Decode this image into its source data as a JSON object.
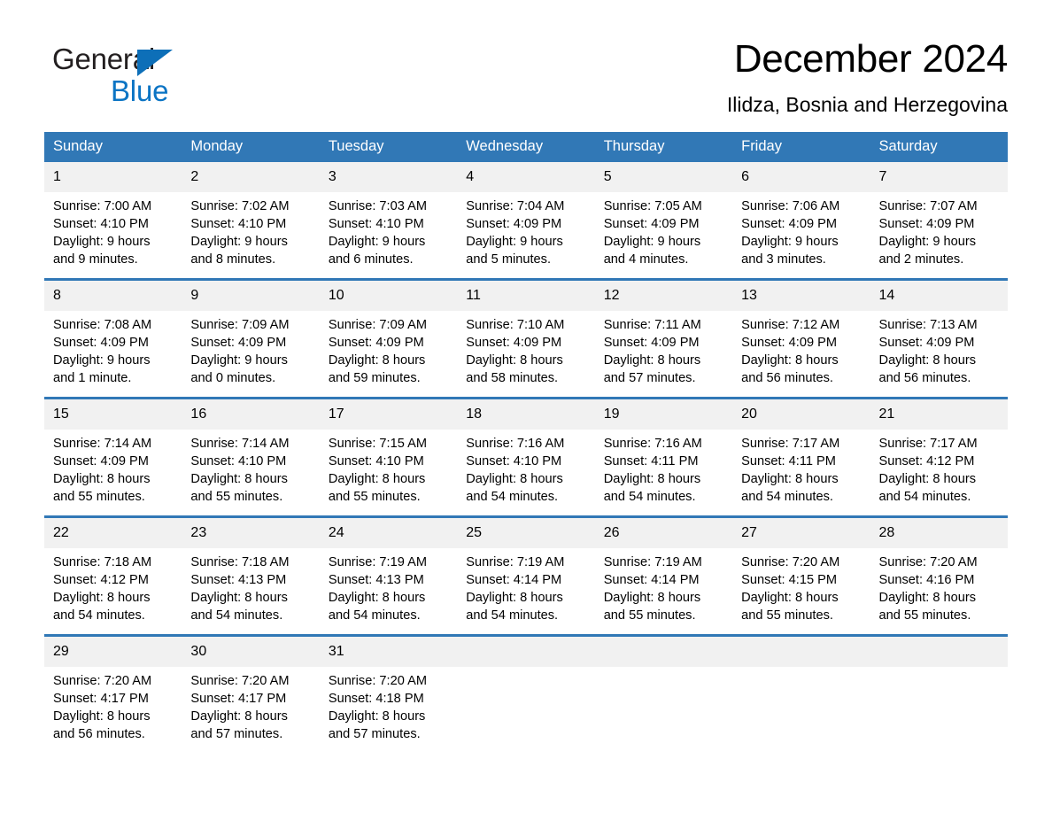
{
  "brand": {
    "name_top": "General",
    "name_bottom": "Blue",
    "accent_color": "#0b74c4",
    "triangle_color": "#0d6fb8"
  },
  "header": {
    "title": "December 2024",
    "subtitle": "Ilidza, Bosnia and Herzegovina"
  },
  "calendar": {
    "header_bg": "#3178b6",
    "header_text_color": "#ffffff",
    "daynum_bg": "#f1f1f1",
    "weekday_headers": [
      "Sunday",
      "Monday",
      "Tuesday",
      "Wednesday",
      "Thursday",
      "Friday",
      "Saturday"
    ],
    "weeks": [
      [
        {
          "day": "1",
          "sunrise": "Sunrise: 7:00 AM",
          "sunset": "Sunset: 4:10 PM",
          "daylight_1": "Daylight: 9 hours",
          "daylight_2": "and 9 minutes."
        },
        {
          "day": "2",
          "sunrise": "Sunrise: 7:02 AM",
          "sunset": "Sunset: 4:10 PM",
          "daylight_1": "Daylight: 9 hours",
          "daylight_2": "and 8 minutes."
        },
        {
          "day": "3",
          "sunrise": "Sunrise: 7:03 AM",
          "sunset": "Sunset: 4:10 PM",
          "daylight_1": "Daylight: 9 hours",
          "daylight_2": "and 6 minutes."
        },
        {
          "day": "4",
          "sunrise": "Sunrise: 7:04 AM",
          "sunset": "Sunset: 4:09 PM",
          "daylight_1": "Daylight: 9 hours",
          "daylight_2": "and 5 minutes."
        },
        {
          "day": "5",
          "sunrise": "Sunrise: 7:05 AM",
          "sunset": "Sunset: 4:09 PM",
          "daylight_1": "Daylight: 9 hours",
          "daylight_2": "and 4 minutes."
        },
        {
          "day": "6",
          "sunrise": "Sunrise: 7:06 AM",
          "sunset": "Sunset: 4:09 PM",
          "daylight_1": "Daylight: 9 hours",
          "daylight_2": "and 3 minutes."
        },
        {
          "day": "7",
          "sunrise": "Sunrise: 7:07 AM",
          "sunset": "Sunset: 4:09 PM",
          "daylight_1": "Daylight: 9 hours",
          "daylight_2": "and 2 minutes."
        }
      ],
      [
        {
          "day": "8",
          "sunrise": "Sunrise: 7:08 AM",
          "sunset": "Sunset: 4:09 PM",
          "daylight_1": "Daylight: 9 hours",
          "daylight_2": "and 1 minute."
        },
        {
          "day": "9",
          "sunrise": "Sunrise: 7:09 AM",
          "sunset": "Sunset: 4:09 PM",
          "daylight_1": "Daylight: 9 hours",
          "daylight_2": "and 0 minutes."
        },
        {
          "day": "10",
          "sunrise": "Sunrise: 7:09 AM",
          "sunset": "Sunset: 4:09 PM",
          "daylight_1": "Daylight: 8 hours",
          "daylight_2": "and 59 minutes."
        },
        {
          "day": "11",
          "sunrise": "Sunrise: 7:10 AM",
          "sunset": "Sunset: 4:09 PM",
          "daylight_1": "Daylight: 8 hours",
          "daylight_2": "and 58 minutes."
        },
        {
          "day": "12",
          "sunrise": "Sunrise: 7:11 AM",
          "sunset": "Sunset: 4:09 PM",
          "daylight_1": "Daylight: 8 hours",
          "daylight_2": "and 57 minutes."
        },
        {
          "day": "13",
          "sunrise": "Sunrise: 7:12 AM",
          "sunset": "Sunset: 4:09 PM",
          "daylight_1": "Daylight: 8 hours",
          "daylight_2": "and 56 minutes."
        },
        {
          "day": "14",
          "sunrise": "Sunrise: 7:13 AM",
          "sunset": "Sunset: 4:09 PM",
          "daylight_1": "Daylight: 8 hours",
          "daylight_2": "and 56 minutes."
        }
      ],
      [
        {
          "day": "15",
          "sunrise": "Sunrise: 7:14 AM",
          "sunset": "Sunset: 4:09 PM",
          "daylight_1": "Daylight: 8 hours",
          "daylight_2": "and 55 minutes."
        },
        {
          "day": "16",
          "sunrise": "Sunrise: 7:14 AM",
          "sunset": "Sunset: 4:10 PM",
          "daylight_1": "Daylight: 8 hours",
          "daylight_2": "and 55 minutes."
        },
        {
          "day": "17",
          "sunrise": "Sunrise: 7:15 AM",
          "sunset": "Sunset: 4:10 PM",
          "daylight_1": "Daylight: 8 hours",
          "daylight_2": "and 55 minutes."
        },
        {
          "day": "18",
          "sunrise": "Sunrise: 7:16 AM",
          "sunset": "Sunset: 4:10 PM",
          "daylight_1": "Daylight: 8 hours",
          "daylight_2": "and 54 minutes."
        },
        {
          "day": "19",
          "sunrise": "Sunrise: 7:16 AM",
          "sunset": "Sunset: 4:11 PM",
          "daylight_1": "Daylight: 8 hours",
          "daylight_2": "and 54 minutes."
        },
        {
          "day": "20",
          "sunrise": "Sunrise: 7:17 AM",
          "sunset": "Sunset: 4:11 PM",
          "daylight_1": "Daylight: 8 hours",
          "daylight_2": "and 54 minutes."
        },
        {
          "day": "21",
          "sunrise": "Sunrise: 7:17 AM",
          "sunset": "Sunset: 4:12 PM",
          "daylight_1": "Daylight: 8 hours",
          "daylight_2": "and 54 minutes."
        }
      ],
      [
        {
          "day": "22",
          "sunrise": "Sunrise: 7:18 AM",
          "sunset": "Sunset: 4:12 PM",
          "daylight_1": "Daylight: 8 hours",
          "daylight_2": "and 54 minutes."
        },
        {
          "day": "23",
          "sunrise": "Sunrise: 7:18 AM",
          "sunset": "Sunset: 4:13 PM",
          "daylight_1": "Daylight: 8 hours",
          "daylight_2": "and 54 minutes."
        },
        {
          "day": "24",
          "sunrise": "Sunrise: 7:19 AM",
          "sunset": "Sunset: 4:13 PM",
          "daylight_1": "Daylight: 8 hours",
          "daylight_2": "and 54 minutes."
        },
        {
          "day": "25",
          "sunrise": "Sunrise: 7:19 AM",
          "sunset": "Sunset: 4:14 PM",
          "daylight_1": "Daylight: 8 hours",
          "daylight_2": "and 54 minutes."
        },
        {
          "day": "26",
          "sunrise": "Sunrise: 7:19 AM",
          "sunset": "Sunset: 4:14 PM",
          "daylight_1": "Daylight: 8 hours",
          "daylight_2": "and 55 minutes."
        },
        {
          "day": "27",
          "sunrise": "Sunrise: 7:20 AM",
          "sunset": "Sunset: 4:15 PM",
          "daylight_1": "Daylight: 8 hours",
          "daylight_2": "and 55 minutes."
        },
        {
          "day": "28",
          "sunrise": "Sunrise: 7:20 AM",
          "sunset": "Sunset: 4:16 PM",
          "daylight_1": "Daylight: 8 hours",
          "daylight_2": "and 55 minutes."
        }
      ],
      [
        {
          "day": "29",
          "sunrise": "Sunrise: 7:20 AM",
          "sunset": "Sunset: 4:17 PM",
          "daylight_1": "Daylight: 8 hours",
          "daylight_2": "and 56 minutes."
        },
        {
          "day": "30",
          "sunrise": "Sunrise: 7:20 AM",
          "sunset": "Sunset: 4:17 PM",
          "daylight_1": "Daylight: 8 hours",
          "daylight_2": "and 57 minutes."
        },
        {
          "day": "31",
          "sunrise": "Sunrise: 7:20 AM",
          "sunset": "Sunset: 4:18 PM",
          "daylight_1": "Daylight: 8 hours",
          "daylight_2": "and 57 minutes."
        },
        {
          "day": "",
          "sunrise": "",
          "sunset": "",
          "daylight_1": "",
          "daylight_2": ""
        },
        {
          "day": "",
          "sunrise": "",
          "sunset": "",
          "daylight_1": "",
          "daylight_2": ""
        },
        {
          "day": "",
          "sunrise": "",
          "sunset": "",
          "daylight_1": "",
          "daylight_2": ""
        },
        {
          "day": "",
          "sunrise": "",
          "sunset": "",
          "daylight_1": "",
          "daylight_2": ""
        }
      ]
    ]
  }
}
